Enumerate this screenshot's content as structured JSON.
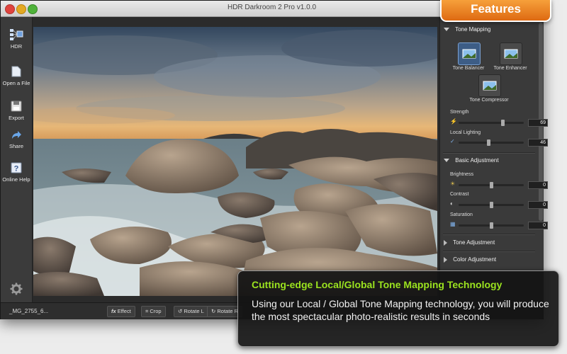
{
  "window": {
    "title": "HDR Darkroom 2 Pro v1.0.0"
  },
  "toolbar": {
    "hdr_label": "HDR",
    "open_label": "Open a File",
    "export_label": "Export",
    "share_label": "Share",
    "help_label": "Online Help"
  },
  "bottom": {
    "filename": "_MG_2755_6...",
    "effect_label": "Effect",
    "crop_label": "Crop",
    "rotate_left_label": "Rotate L",
    "rotate_right_label": "Rotate R"
  },
  "panel": {
    "tone_mapping": {
      "title": "Tone Mapping",
      "modes": [
        "Tone Balancer",
        "Tone Enhancer",
        "Tone Compressor"
      ],
      "selected_mode": "Tone Balancer",
      "strength": {
        "label": "Strength",
        "value": "69",
        "fraction": 0.69
      },
      "local_lighting": {
        "label": "Local Lighting",
        "value": "46",
        "fraction": 0.46
      }
    },
    "basic": {
      "title": "Basic Adjustment",
      "brightness": {
        "label": "Brightness",
        "value": "0",
        "fraction": 0.5
      },
      "contrast": {
        "label": "Contrast",
        "value": "0",
        "fraction": 0.5
      },
      "saturation": {
        "label": "Saturation",
        "value": "0",
        "fraction": 0.5
      }
    },
    "tone_adjustment_title": "Tone Adjustment",
    "color_adjustment_title": "Color Adjustment"
  },
  "badge": {
    "label": "Features"
  },
  "callout": {
    "title": "Cutting-edge Local/Global Tone Mapping Technology",
    "body": "Using our Local / Global Tone Mapping technology, you will produce the most spectacular photo-realistic results in seconds"
  },
  "colors": {
    "accent_orange": "#f08a24",
    "callout_green": "#9be31f",
    "selected_blue": "#3d5d86"
  }
}
